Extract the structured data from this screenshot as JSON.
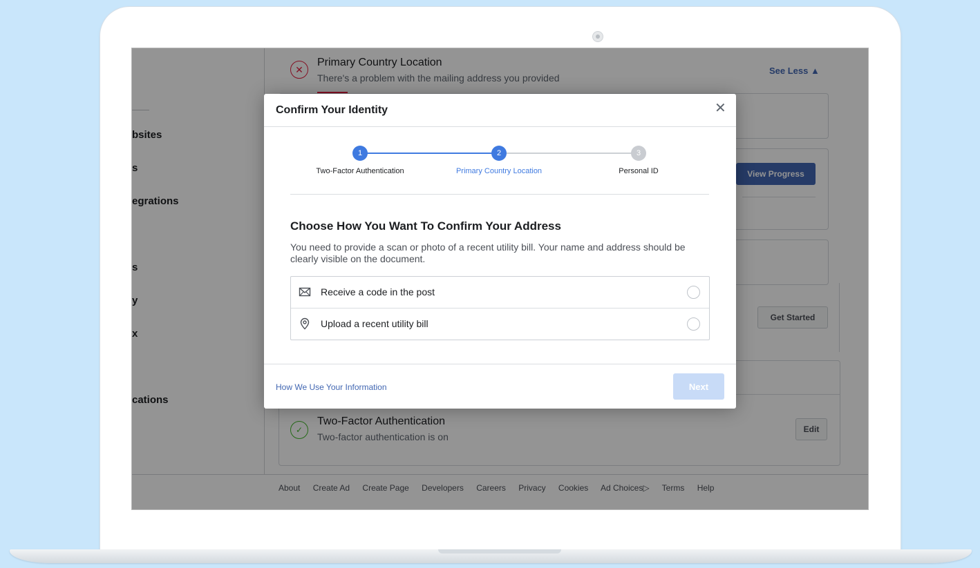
{
  "colors": {
    "accent": "#4267b2",
    "step_active": "#3f7ae0",
    "error": "#e41e3f",
    "success": "#42b72a"
  },
  "sidebar": {
    "items": [
      "bsites",
      "s",
      "egrations",
      "s",
      "y",
      "x",
      "cations"
    ]
  },
  "background": {
    "primary_country": {
      "title": "Primary Country Location",
      "subtitle": "There's a problem with the mailing address you provided",
      "see_less": "See Less ▲"
    },
    "view_progress": "View Progress",
    "get_started": "Get Started",
    "two_factor": {
      "title": "Two-Factor Authentication",
      "subtitle": "Two-factor authentication is on",
      "edit": "Edit"
    },
    "footer_links": [
      "About",
      "Create Ad",
      "Create Page",
      "Developers",
      "Careers",
      "Privacy",
      "Cookies",
      "Ad Choices▷",
      "Terms",
      "Help"
    ]
  },
  "modal": {
    "title": "Confirm Your Identity",
    "close": "✕",
    "steps": [
      {
        "number": "1",
        "label": "Two-Factor Authentication",
        "state": "done"
      },
      {
        "number": "2",
        "label": "Primary Country Location",
        "state": "current"
      },
      {
        "number": "3",
        "label": "Personal ID",
        "state": "pending"
      }
    ],
    "section_title": "Choose How You Want To Confirm Your Address",
    "section_desc": "You need to provide a scan or photo of a recent utility bill. Your name and address should be clearly visible on the document.",
    "options": [
      {
        "label": "Receive a code in the post",
        "icon": "envelope-icon",
        "selected": false
      },
      {
        "label": "Upload a recent utility bill",
        "icon": "location-pin-icon",
        "selected": false
      }
    ],
    "info_link": "How We Use Your Information",
    "next": "Next"
  }
}
